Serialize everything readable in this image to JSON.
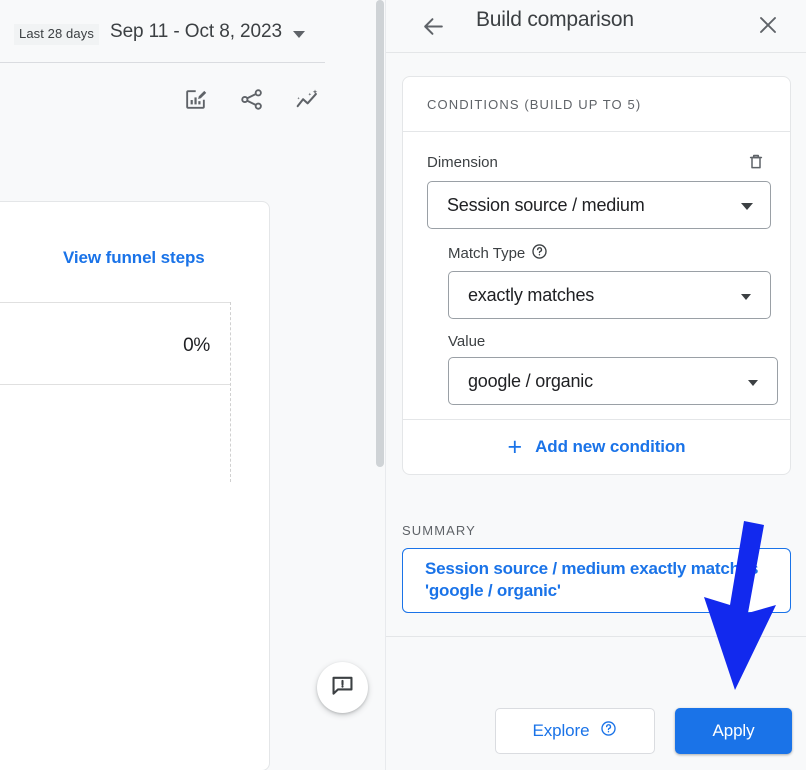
{
  "left_panel": {
    "date_chip": "Last 28 days",
    "date_range": "Sep 11 - Oct 8, 2023",
    "toolbar_icons": [
      "edit-chart-icon",
      "share-icon",
      "insights-icon"
    ],
    "card": {
      "view_funnel_steps_link": "View funnel steps",
      "table_value": "0%"
    },
    "feedback_icon": "feedback-message-icon"
  },
  "right_panel": {
    "header": {
      "back_icon": "arrow-back-icon",
      "title": "Build comparison",
      "close_icon": "close-icon"
    },
    "conditions": {
      "header_label": "CONDITIONS (BUILD UP TO 5)",
      "delete_icon": "trash-icon",
      "dimension": {
        "label": "Dimension",
        "value": "Session source / medium"
      },
      "match_type": {
        "label": "Match Type",
        "help_icon": "help-circle-icon",
        "value": "exactly matches"
      },
      "value_field": {
        "label": "Value",
        "value": "google / organic"
      },
      "add_condition": {
        "plus": "+",
        "label": "Add new condition"
      }
    },
    "summary": {
      "label": "SUMMARY",
      "text": "Session source / medium exactly matches 'google / organic'"
    },
    "footer": {
      "explore_label": "Explore",
      "explore_help_icon": "help-circle-icon",
      "apply_label": "Apply"
    }
  },
  "annotation": {
    "arrow_color": "#1229ee",
    "points_to": "apply-button"
  },
  "colors": {
    "accent_blue": "#1a73e8",
    "panel_background": "#f8f9fa",
    "card_background": "#ffffff",
    "border": "#e4e6e8",
    "text_primary": "#3c4043",
    "text_secondary": "#5f6368",
    "annotation_blue": "#1229ee"
  }
}
